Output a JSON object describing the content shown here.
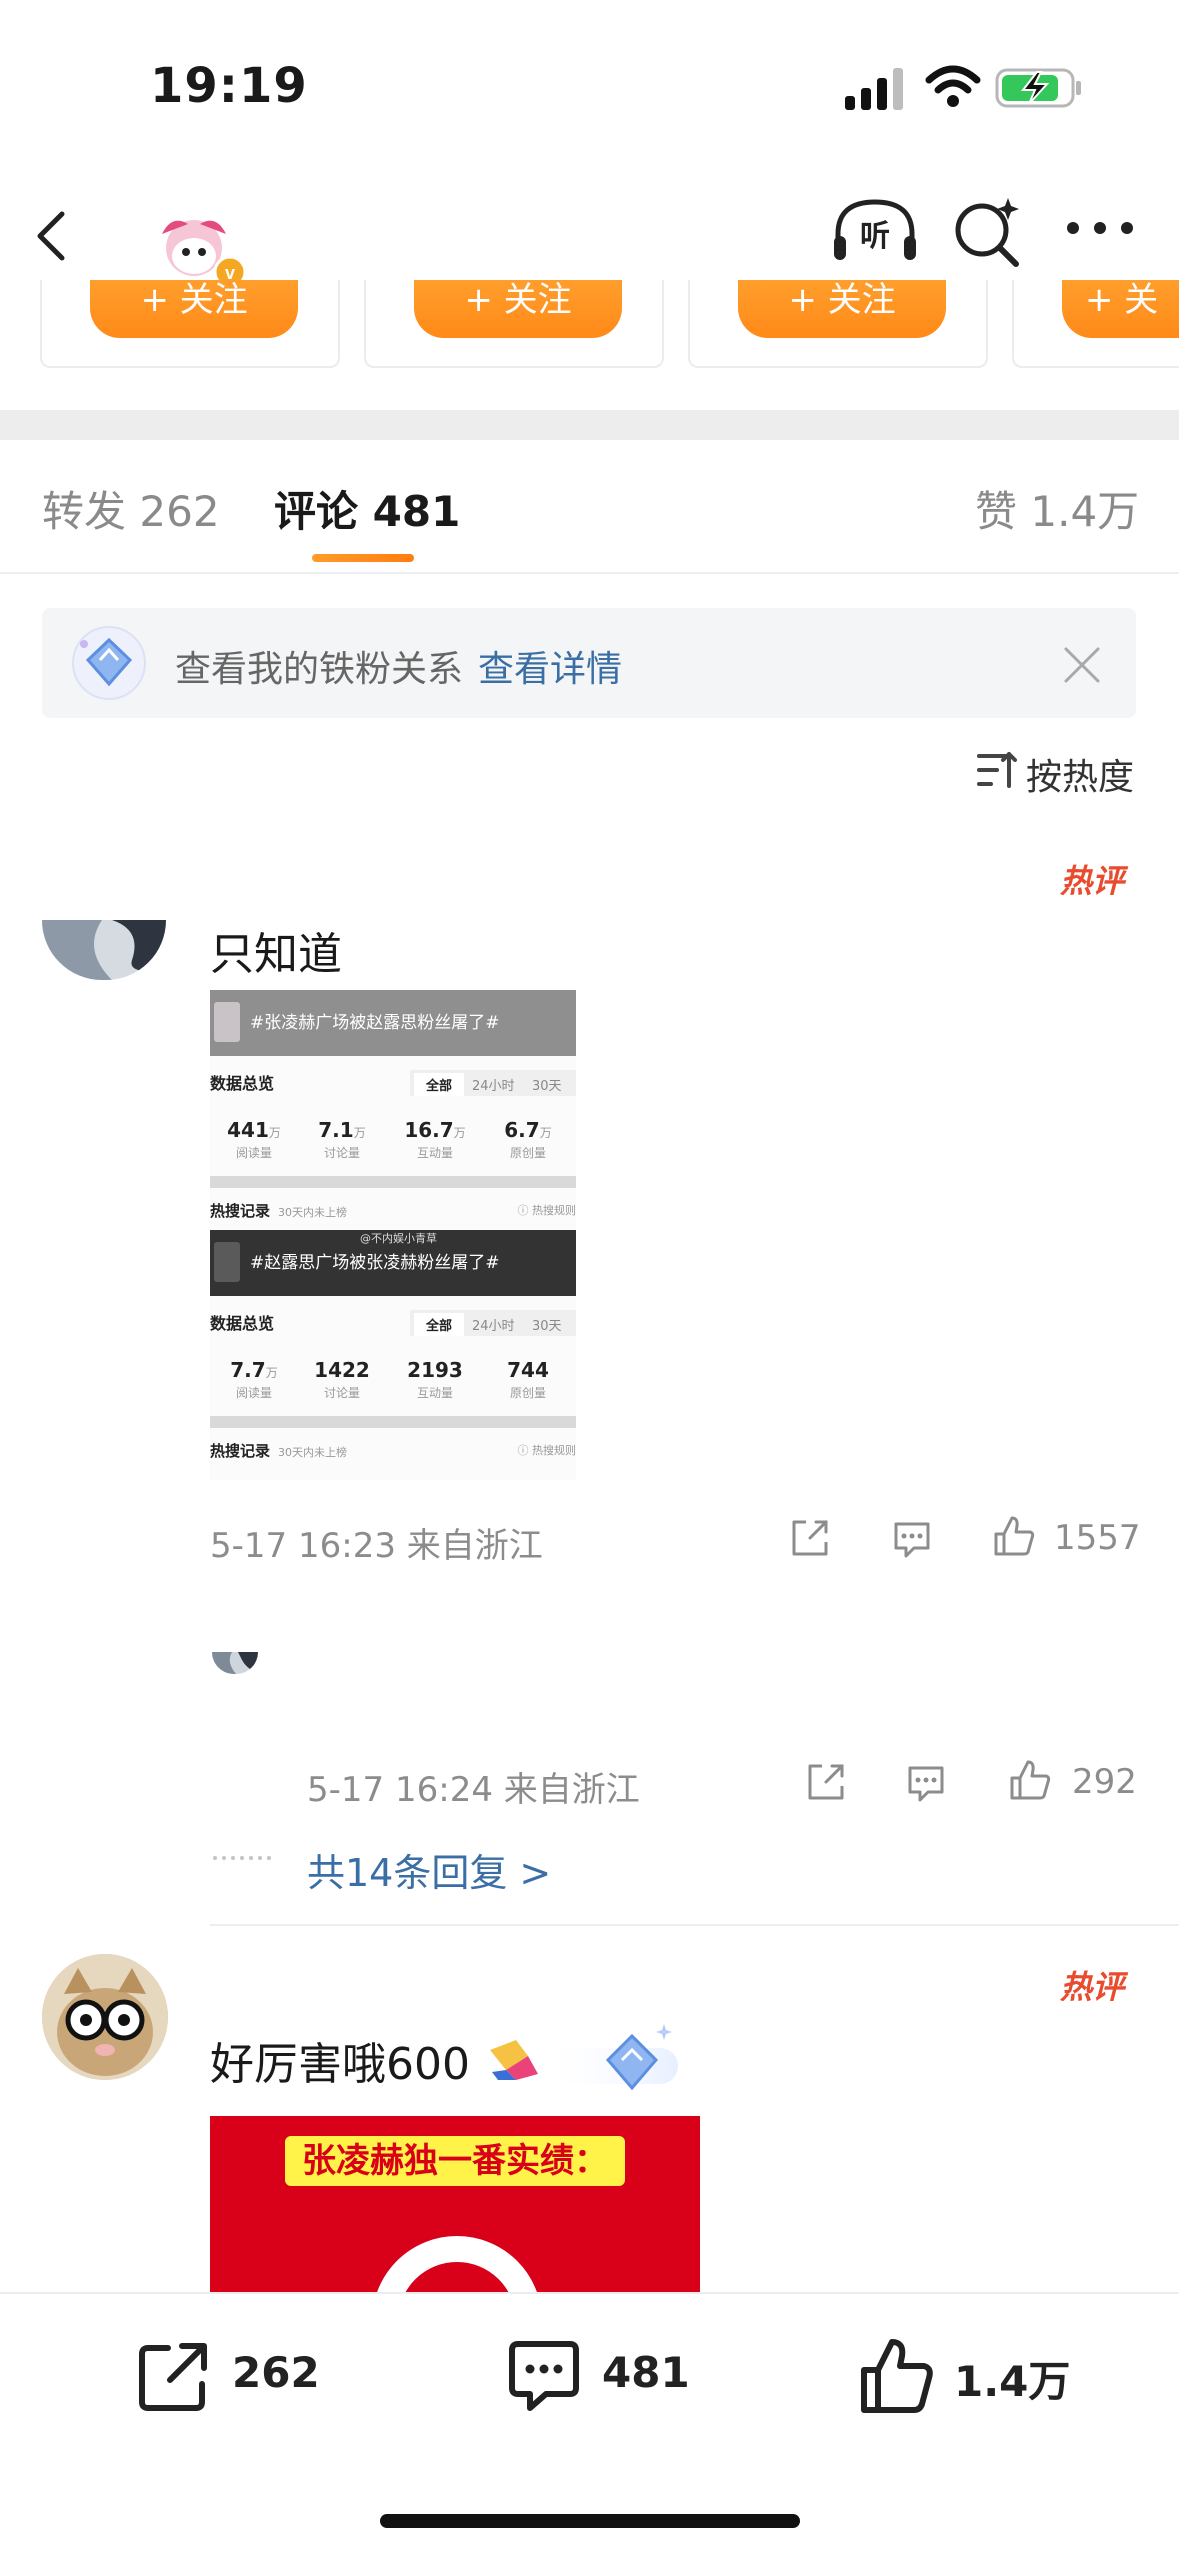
{
  "status_bar": {
    "time": "19:19"
  },
  "nav": {
    "listen_icon": "headphones-listen-icon",
    "listen_label": "听",
    "search_icon": "search-sparkle-icon",
    "more_icon": "more-dots-icon",
    "verified_badge": "v"
  },
  "follow_cards": [
    {
      "button_label": "+ 关注"
    },
    {
      "button_label": "+ 关注"
    },
    {
      "button_label": "+ 关注"
    },
    {
      "button_label": "+ 关"
    }
  ],
  "tabs": {
    "repost_label": "转发",
    "repost_count": "262",
    "comment_label": "评论",
    "comment_count": "481",
    "like_label": "赞",
    "like_count": "1.4万"
  },
  "banner": {
    "text": "查看我的铁粉关系",
    "link": "查看详情"
  },
  "sort": {
    "label": "按热度"
  },
  "comments": [
    {
      "hot_badge": "热评",
      "text": "只知道",
      "image": {
        "section1": {
          "topic": "#张凌赫广场被赵露思粉丝屠了#",
          "overview_label": "数据总览",
          "seg": [
            "全部",
            "24小时",
            "30天"
          ],
          "stats": [
            {
              "value": "441",
              "unit": "万",
              "label": "阅读量"
            },
            {
              "value": "7.1",
              "unit": "万",
              "label": "讨论量"
            },
            {
              "value": "16.7",
              "unit": "万",
              "label": "互动量"
            },
            {
              "value": "6.7",
              "unit": "万",
              "label": "原创量"
            }
          ],
          "hot_record": "热搜记录",
          "hot_note": "30天内未上榜",
          "hot_rule": "ⓘ 热搜规则"
        },
        "section2": {
          "watermark": "@不内娱小青草",
          "topic": "#赵露思广场被张凌赫粉丝屠了#",
          "overview_label": "数据总览",
          "seg": [
            "全部",
            "24小时",
            "30天"
          ],
          "stats": [
            {
              "value": "7.7",
              "unit": "万",
              "label": "阅读量"
            },
            {
              "value": "1422",
              "unit": "",
              "label": "讨论量"
            },
            {
              "value": "2193",
              "unit": "",
              "label": "互动量"
            },
            {
              "value": "744",
              "unit": "",
              "label": "原创量"
            }
          ],
          "hot_record": "热搜记录",
          "hot_note": "30天内未上榜",
          "hot_rule": "ⓘ 热搜规则"
        }
      },
      "meta": "5-17 16:23  来自浙江",
      "like_count": "1557"
    },
    {
      "meta": "5-17 16:24  来自浙江",
      "like_count": "292",
      "replies_link": "共14条回复 >"
    },
    {
      "hot_badge": "热评",
      "text": "好厉害哦600",
      "poster_title": "张凌赫独一番实绩："
    }
  ],
  "bottom_bar": {
    "repost_count": "262",
    "comment_count": "481",
    "like_count": "1.4万"
  },
  "colors": {
    "accent_orange": "#ff8a18",
    "link_blue": "#3a6ea5",
    "hot_red": "#e84b2e",
    "poster_red": "#d9001a"
  }
}
